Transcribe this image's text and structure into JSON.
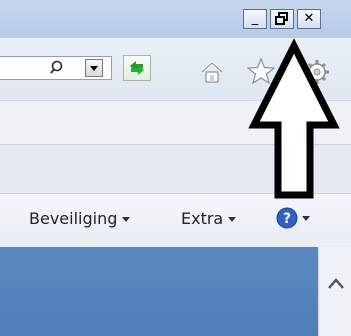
{
  "window": {
    "min_label": "_",
    "max_label": "🗗",
    "close_label": "✕"
  },
  "menu": {
    "security_label": "Beveiliging",
    "extra_label": "Extra"
  },
  "colors": {
    "titlebar": "#c6d7ee",
    "content": "#5a89c2"
  },
  "icons": [
    "search-icon",
    "dropdown-icon",
    "refresh-icon",
    "home-icon",
    "favorites-star-icon",
    "tools-gear-icon",
    "help-icon",
    "scroll-up-icon",
    "pointer-arrow-icon"
  ]
}
